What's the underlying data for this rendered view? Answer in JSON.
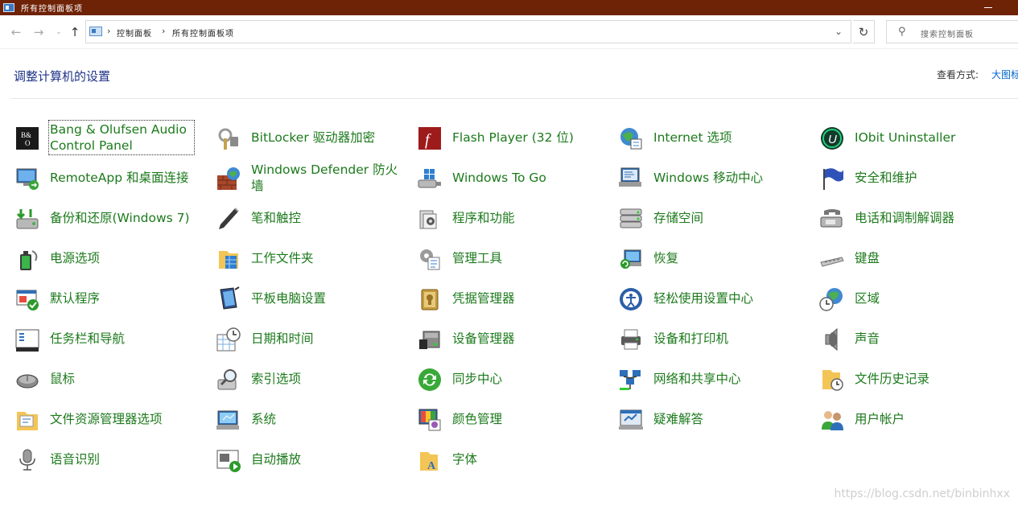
{
  "window": {
    "title": "所有控制面板项"
  },
  "address": {
    "crumbs": [
      "控制面板",
      "所有控制面板项"
    ],
    "search_placeholder": "搜索控制面板"
  },
  "header": {
    "title": "调整计算机的设置",
    "view_by_label": "查看方式:",
    "view_by_value": "大图标"
  },
  "items": [
    {
      "label": "Bang & Olufsen Audio Control Panel",
      "icon": "bang-olufsen-icon"
    },
    {
      "label": "BitLocker 驱动器加密",
      "icon": "bitlocker-icon"
    },
    {
      "label": "Flash Player (32 位)",
      "icon": "flash-player-icon"
    },
    {
      "label": "Internet 选项",
      "icon": "internet-options-icon"
    },
    {
      "label": "IObit Uninstaller",
      "icon": "iobit-uninstaller-icon"
    },
    {
      "label": "RemoteApp 和桌面连接",
      "icon": "remoteapp-icon"
    },
    {
      "label": "Windows Defender 防火墙",
      "icon": "firewall-icon"
    },
    {
      "label": "Windows To Go",
      "icon": "windows-to-go-icon"
    },
    {
      "label": "Windows 移动中心",
      "icon": "mobility-center-icon"
    },
    {
      "label": "安全和维护",
      "icon": "security-flag-icon"
    },
    {
      "label": "备份和还原(Windows 7)",
      "icon": "backup-icon"
    },
    {
      "label": "笔和触控",
      "icon": "pen-icon"
    },
    {
      "label": "程序和功能",
      "icon": "programs-icon"
    },
    {
      "label": "存储空间",
      "icon": "storage-icon"
    },
    {
      "label": "电话和调制解调器",
      "icon": "phone-modem-icon"
    },
    {
      "label": "电源选项",
      "icon": "power-icon"
    },
    {
      "label": "工作文件夹",
      "icon": "work-folders-icon"
    },
    {
      "label": "管理工具",
      "icon": "admin-tools-icon"
    },
    {
      "label": "恢复",
      "icon": "recovery-icon"
    },
    {
      "label": "键盘",
      "icon": "keyboard-icon"
    },
    {
      "label": "默认程序",
      "icon": "default-programs-icon"
    },
    {
      "label": "平板电脑设置",
      "icon": "tablet-icon"
    },
    {
      "label": "凭据管理器",
      "icon": "credential-icon"
    },
    {
      "label": "轻松使用设置中心",
      "icon": "ease-of-access-icon"
    },
    {
      "label": "区域",
      "icon": "region-icon"
    },
    {
      "label": "任务栏和导航",
      "icon": "taskbar-icon"
    },
    {
      "label": "日期和时间",
      "icon": "date-time-icon"
    },
    {
      "label": "设备管理器",
      "icon": "device-manager-icon"
    },
    {
      "label": "设备和打印机",
      "icon": "printer-icon"
    },
    {
      "label": "声音",
      "icon": "sound-icon"
    },
    {
      "label": "鼠标",
      "icon": "mouse-icon"
    },
    {
      "label": "索引选项",
      "icon": "indexing-icon"
    },
    {
      "label": "同步中心",
      "icon": "sync-icon"
    },
    {
      "label": "网络和共享中心",
      "icon": "network-icon"
    },
    {
      "label": "文件历史记录",
      "icon": "file-history-icon"
    },
    {
      "label": "文件资源管理器选项",
      "icon": "folder-options-icon"
    },
    {
      "label": "系统",
      "icon": "system-icon"
    },
    {
      "label": "颜色管理",
      "icon": "color-management-icon"
    },
    {
      "label": "疑难解答",
      "icon": "troubleshooting-icon"
    },
    {
      "label": "用户帐户",
      "icon": "user-accounts-icon"
    },
    {
      "label": "语音识别",
      "icon": "microphone-icon"
    },
    {
      "label": "自动播放",
      "icon": "autoplay-icon"
    },
    {
      "label": "字体",
      "icon": "fonts-icon"
    }
  ],
  "watermark": "https://blog.csdn.net/binbinhxx"
}
